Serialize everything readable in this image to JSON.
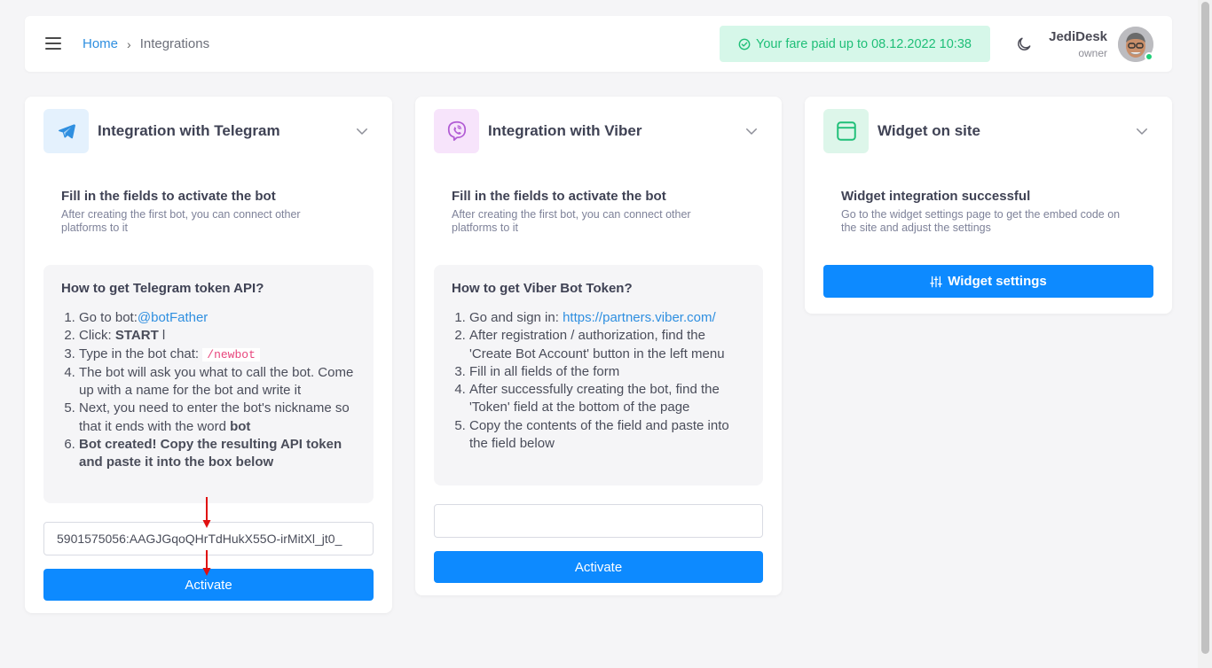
{
  "header": {
    "breadcrumb_home": "Home",
    "breadcrumb_sep": "›",
    "breadcrumb_current": "Integrations",
    "fare_text": "Your fare paid up to 08.12.2022 10:38",
    "user_name": "JediDesk",
    "user_role": "owner"
  },
  "telegram": {
    "title": "Integration with Telegram",
    "sub_title": "Fill in the fields to activate the bot",
    "sub_text": "After creating the first bot, you can connect other platforms to it",
    "howto_title": "How to get Telegram token API?",
    "step1_text": "Go to bot:",
    "step1_link": "@botFather",
    "step2_text": "Click: ",
    "step2_bold": "START",
    "step2_after": " l",
    "step3_text": "Type in the bot chat: ",
    "step3_code": "/newbot",
    "step4_text": "The bot will ask you what to call the bot. Come up with a name for the bot and write it",
    "step5_text": "Next, you need to enter the bot's nickname so that it ends with the word ",
    "step5_bold": "bot",
    "step6_bold": "Bot created! Copy the resulting API token and paste it into the box below",
    "token_value": "5901575056:AAGJGqoQHrTdHukX55O-irMitXl_jt0_",
    "activate_label": "Activate"
  },
  "viber": {
    "title": "Integration with Viber",
    "sub_title": "Fill in the fields to activate the bot",
    "sub_text": "After creating the first bot, you can connect other platforms to it",
    "howto_title": "How to get Viber Bot Token?",
    "step1_text": "Go and sign in: ",
    "step1_link": "https://partners.viber.com/",
    "step2_text": "After registration / authorization, find the 'Create Bot Account' button in the left menu",
    "step3_text": "Fill in all fields of the form",
    "step4_text": "After successfully creating the bot, find the 'Token' field at the bottom of the page",
    "step5_text": "Copy the contents of the field and paste into the field below",
    "token_value": "",
    "activate_label": "Activate"
  },
  "widget": {
    "title": "Widget on site",
    "sub_title": "Widget integration successful",
    "sub_text": "Go to the widget settings page to get the embed code on the site and adjust the settings",
    "button_label": "Widget settings"
  },
  "colors": {
    "accent": "#0d8aff",
    "link": "#2f8fe0",
    "success": "#1fbf78",
    "arrow": "#e01010"
  }
}
